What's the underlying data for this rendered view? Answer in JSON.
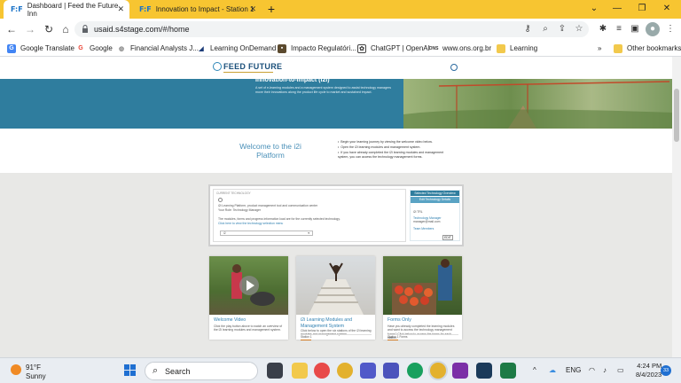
{
  "browser": {
    "tabs": [
      {
        "favicon": "F:F",
        "title": "Dashboard | Feed the Future Inn",
        "active": true
      },
      {
        "favicon": "F:F",
        "title": "Innovation to Impact - Station 1",
        "active": false
      }
    ],
    "url": "usaid.s4stage.com/#/home",
    "bookmarks": [
      {
        "icon": "google-translate-icon",
        "label": "Google Translate"
      },
      {
        "icon": "google-icon",
        "label": "Google"
      },
      {
        "icon": "globe-icon",
        "label": "Financial Analysts J..."
      },
      {
        "icon": "learning-ondemand-icon",
        "label": "Learning OnDemand"
      },
      {
        "icon": "page-icon",
        "label": "Impacto Regulatóri..."
      },
      {
        "icon": "chatgpt-icon",
        "label": "ChatGPT | OpenAI"
      },
      {
        "icon": "ons-icon",
        "label": "www.ons.org.br"
      },
      {
        "icon": "folder-icon",
        "label": "Learning"
      }
    ],
    "other_bookmarks": "Other bookmarks",
    "more_bookmarks": "»"
  },
  "site": {
    "logo": "FEED FUTURE",
    "hero_title": "Innovation-to-Impact (i2i)",
    "hero_desc": "A set of e-learning modules and a management system designed to assist technology managers move their innovations along the product life cycle to market and sustained impact.",
    "welcome_title": "Welcome to the i2i Platform",
    "welcome_items": [
      "Begin your learning journey by viewing the welcome video below.",
      "Open the i2i learning modules and management system.",
      "If you have already completed the i2i learning modules and management system, you can access the technology management forms."
    ],
    "panel": {
      "heading": "CURRENT TECHNOLOGY",
      "line1": "i2i Learning Platform, product management tool and communication center",
      "line2": "Your Role: Technology Manager",
      "line3": "The modules, forms and progress information load are for the currently selected technology.",
      "link": "Click here to view the technology selection menu",
      "select_value": "i2",
      "side_heading": "Selected Technology Overview",
      "side_sub": "Edit Technology Details",
      "side_fields": [
        "i2i TRL",
        "Technology Manager",
        "manager@mail.com",
        "Team Members"
      ],
      "edit_label": "EDIT"
    },
    "cards": [
      {
        "title": "Welcome Video",
        "desc": "Click the play button above to watch an overview of the i2i learning modules and management system.",
        "status": ""
      },
      {
        "title": "i2i Learning Modules and Management System",
        "desc": "Click below to open the six stations of the i2i learning modules and management system.",
        "status": "Station 1"
      },
      {
        "title": "Forms Only",
        "desc": "Have you already completed the learning modules and want to access the technology management forms? Click below to access the forms for each station.",
        "status": "Station 1 Forms"
      }
    ]
  },
  "taskbar": {
    "weather_temp": "91°F",
    "weather_cond": "Sunny",
    "search_placeholder": "Search",
    "lang": "ENG",
    "time": "4:24 PM",
    "date": "8/4/2023",
    "notif_count": "33"
  }
}
